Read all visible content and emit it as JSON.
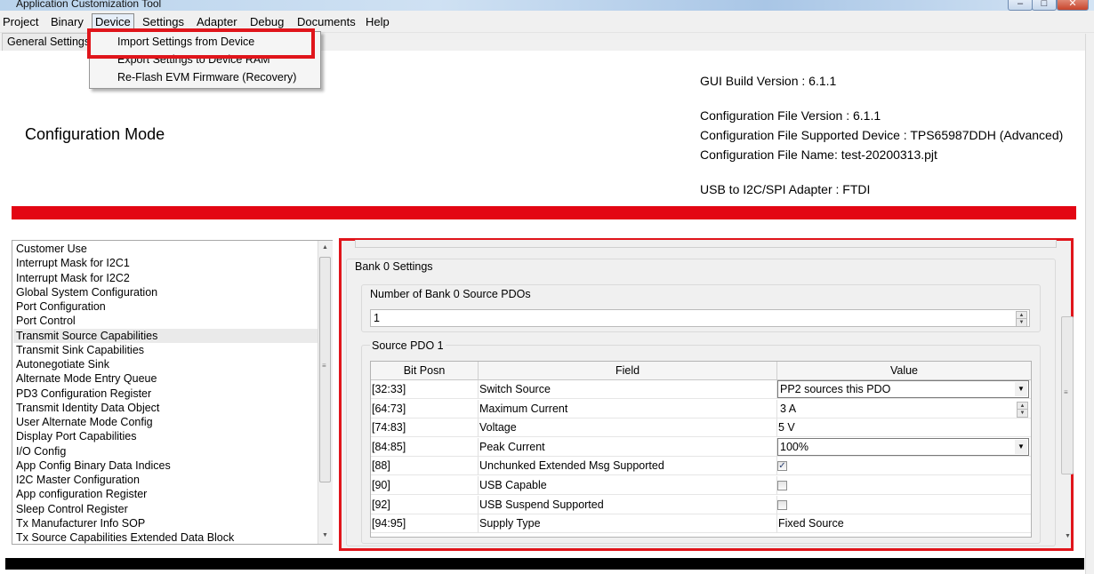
{
  "window": {
    "title": "Application Customization Tool"
  },
  "menubar": [
    {
      "label": "Project"
    },
    {
      "label": "Binary"
    },
    {
      "label": "Device"
    },
    {
      "label": "Settings"
    },
    {
      "label": "Adapter"
    },
    {
      "label": "Debug"
    },
    {
      "label": "Documents"
    },
    {
      "label": "Help"
    }
  ],
  "tabs": {
    "general": "General Settings"
  },
  "device_menu": [
    {
      "label": "Import Settings from Device"
    },
    {
      "label": "Export Settings to Device RAM"
    },
    {
      "label": "Re-Flash EVM Firmware (Recovery)"
    }
  ],
  "info": {
    "gui_build": "GUI Build Version : 6.1.1",
    "config_file_version": "Configuration File Version : 6.1.1",
    "config_supported_device": "Configuration File Supported Device : TPS65987DDH (Advanced)",
    "config_file_name": "Configuration File Name: test-20200313.pjt",
    "adapter": "USB to I2C/SPI Adapter : FTDI"
  },
  "mode_title": "Configuration Mode",
  "register_list": [
    "Customer Use",
    "Interrupt Mask for I2C1",
    "Interrupt Mask for I2C2",
    "Global System Configuration",
    "Port Configuration",
    "Port Control",
    "Transmit Source Capabilities",
    "Transmit Sink Capabilities",
    "Autonegotiate Sink",
    "Alternate Mode Entry Queue",
    "PD3 Configuration Register",
    "Transmit Identity Data Object",
    "User Alternate Mode Config",
    "Display Port Capabilities",
    "I/O Config",
    "App Config Binary Data Indices",
    "I2C Master Configuration",
    "App configuration Register",
    "Sleep Control Register",
    "Tx Manufacturer Info SOP",
    "Tx Source Capabilities Extended Data Block"
  ],
  "selected_register": "Transmit Source Capabilities",
  "bank": {
    "title": "Bank 0 Settings",
    "num_label": "Number of Bank 0 Source PDOs",
    "num_value": "1",
    "pdo_title": "Source PDO 1"
  },
  "table": {
    "headers": [
      "Bit Posn",
      "Field",
      "Value"
    ],
    "rows": [
      {
        "bit": "[32:33]",
        "field": "Switch Source",
        "value": "PP2 sources this PDO",
        "kind": "combo"
      },
      {
        "bit": "[64:73]",
        "field": "Maximum Current",
        "value": "3 A",
        "kind": "spinner"
      },
      {
        "bit": "[74:83]",
        "field": "Voltage",
        "value": "5 V",
        "kind": "text"
      },
      {
        "bit": "[84:85]",
        "field": "Peak Current",
        "value": "100%",
        "kind": "combo"
      },
      {
        "bit": "[88]",
        "field": "Unchunked Extended Msg Supported",
        "checked": true,
        "kind": "check"
      },
      {
        "bit": "[90]",
        "field": "USB Capable",
        "checked": false,
        "kind": "check"
      },
      {
        "bit": "[92]",
        "field": "USB Suspend Supported",
        "checked": false,
        "kind": "check"
      },
      {
        "bit": "[94:95]",
        "field": "Supply Type",
        "value": "Fixed Source",
        "kind": "text"
      }
    ]
  },
  "colors": {
    "accent_red": "#e30613",
    "highlight_border": "#e0151b"
  }
}
